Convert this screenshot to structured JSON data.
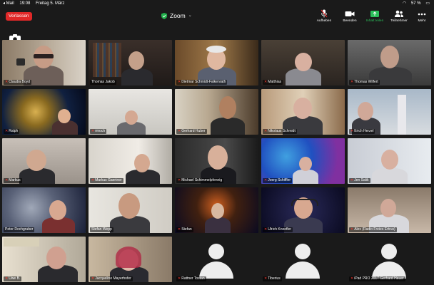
{
  "status": {
    "carrier": "◂ Mail",
    "time": "19:08",
    "date": "Freitag 5. März",
    "battery": "57 %"
  },
  "toolbar": {
    "leave": "Verlassen",
    "title": "Zoom",
    "buttons": [
      {
        "label": "Aufheben",
        "icon": "mic-muted-icon"
      },
      {
        "label": "Beenden",
        "icon": "video-icon"
      },
      {
        "label": "Inhalt teilen",
        "icon": "share-screen-icon"
      },
      {
        "label": "Teilnehmer",
        "icon": "participants-icon"
      },
      {
        "label": "Mehr",
        "icon": "more-icon"
      }
    ],
    "share_color": "#2bbf5a",
    "leave_color": "#e02828"
  },
  "participants": [
    {
      "name": "Claudia Boyd",
      "muted": true
    },
    {
      "name": "Thomas Jakob",
      "muted": false
    },
    {
      "name": "Dietmar Schmidt-Falkenrath",
      "muted": true
    },
    {
      "name": "Matthias",
      "muted": true
    },
    {
      "name": "Thomas Wilfert",
      "muted": true
    },
    {
      "name": "Ralph",
      "muted": true
    },
    {
      "name": "rmoch",
      "muted": true
    },
    {
      "name": "Gerhard Huber",
      "muted": true
    },
    {
      "name": "Nikolaus Schmidt",
      "muted": true
    },
    {
      "name": "Erich Herzel",
      "muted": true
    },
    {
      "name": "Markus",
      "muted": true
    },
    {
      "name": "Markus Gaertner",
      "muted": true
    },
    {
      "name": "Michael Schimmelpfennig",
      "muted": true
    },
    {
      "name": "Joerg Schiffler",
      "muted": true
    },
    {
      "name": "Jen Salik",
      "muted": true
    },
    {
      "name": "Peter Dochgruber",
      "muted": false
    },
    {
      "name": "Stefan Wepp",
      "muted": false
    },
    {
      "name": "Stefan",
      "muted": true
    },
    {
      "name": "Ulrich Knoefler",
      "muted": true
    },
    {
      "name": "Alex (Radio Freies Ertrus)",
      "muted": true
    },
    {
      "name": "Uwe B.",
      "muted": true
    },
    {
      "name": "Jacqueline Mayerhofer",
      "muted": true
    },
    {
      "name": "Rattner Tostan",
      "muted": true
    },
    {
      "name": "Tiberius",
      "muted": true
    },
    {
      "name": "iPad PRO 2017 Gerhard Hauer",
      "muted": true
    }
  ]
}
